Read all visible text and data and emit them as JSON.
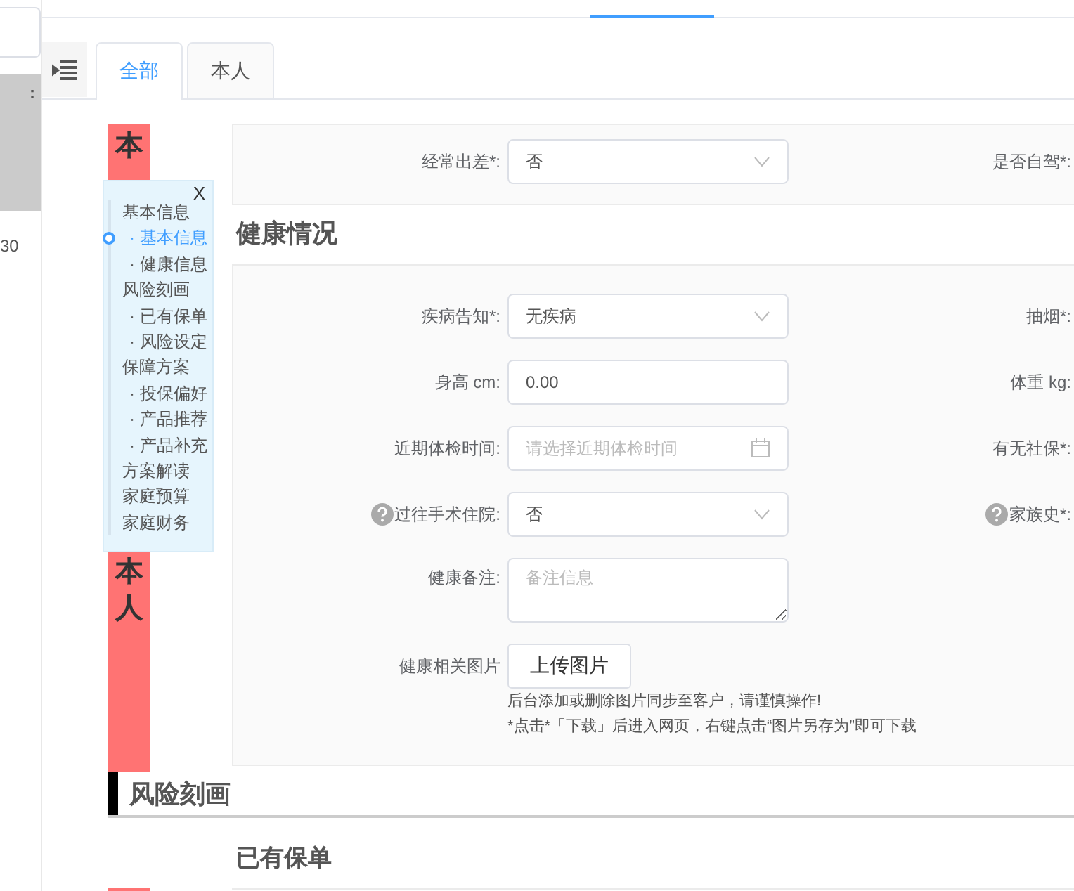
{
  "left_panel": {
    "label": ":",
    "value": "30"
  },
  "tabs": [
    {
      "label": "全部",
      "selected": true
    },
    {
      "label": "本人",
      "selected": false
    }
  ],
  "person_strip": {
    "top_label": "本",
    "label": "本人"
  },
  "nav": {
    "close": "X",
    "items": [
      {
        "label": "基本信息",
        "children": [
          {
            "label": "· 基本信息",
            "selected": true
          },
          {
            "label": "· 健康信息",
            "selected": false
          }
        ]
      },
      {
        "label": "风险刻画",
        "children": [
          {
            "label": "· 已有保单",
            "selected": false
          },
          {
            "label": "· 风险设定",
            "selected": false
          }
        ]
      },
      {
        "label": "保障方案",
        "children": [
          {
            "label": "· 投保偏好",
            "selected": false
          },
          {
            "label": "· 产品推荐",
            "selected": false
          },
          {
            "label": "· 产品补充",
            "selected": false
          }
        ]
      },
      {
        "label": "方案解读"
      },
      {
        "label": "家庭预算"
      },
      {
        "label": "家庭财务"
      }
    ]
  },
  "basic_card": {
    "rows": [
      {
        "label": "经常出差*:",
        "help": false,
        "kind": "select",
        "value": "否",
        "right_label": "是否自驾*:",
        "right_help": false
      }
    ]
  },
  "health": {
    "title": "健康情况",
    "rows": [
      {
        "label": "疾病告知*:",
        "help": false,
        "kind": "select",
        "value": "无疾病",
        "right_label": "抽烟*:",
        "right_help": false
      },
      {
        "label": "身高 cm:",
        "help": false,
        "kind": "input",
        "value": "0.00",
        "right_label": "体重 kg:",
        "right_help": false
      },
      {
        "label": "近期体检时间:",
        "help": false,
        "kind": "date",
        "placeholder": "请选择近期体检时间",
        "right_label": "有无社保*:",
        "right_help": false
      },
      {
        "label": "过往手术住院:",
        "help": true,
        "kind": "select",
        "value": "否",
        "right_label": "家族史*:",
        "right_help": true
      },
      {
        "label": "健康备注:",
        "help": false,
        "kind": "textarea",
        "placeholder": "备注信息"
      }
    ],
    "upload": {
      "label": "健康相关图片",
      "button": "上传图片",
      "notes": [
        "后台添加或删除图片同步至客户，请谨慎操作!",
        "*点击*「下载」后进入网页，右键点击“图片另存为”即可下载"
      ]
    }
  },
  "risk_section": {
    "title": "风险刻画",
    "subtitle": "已有保单"
  }
}
